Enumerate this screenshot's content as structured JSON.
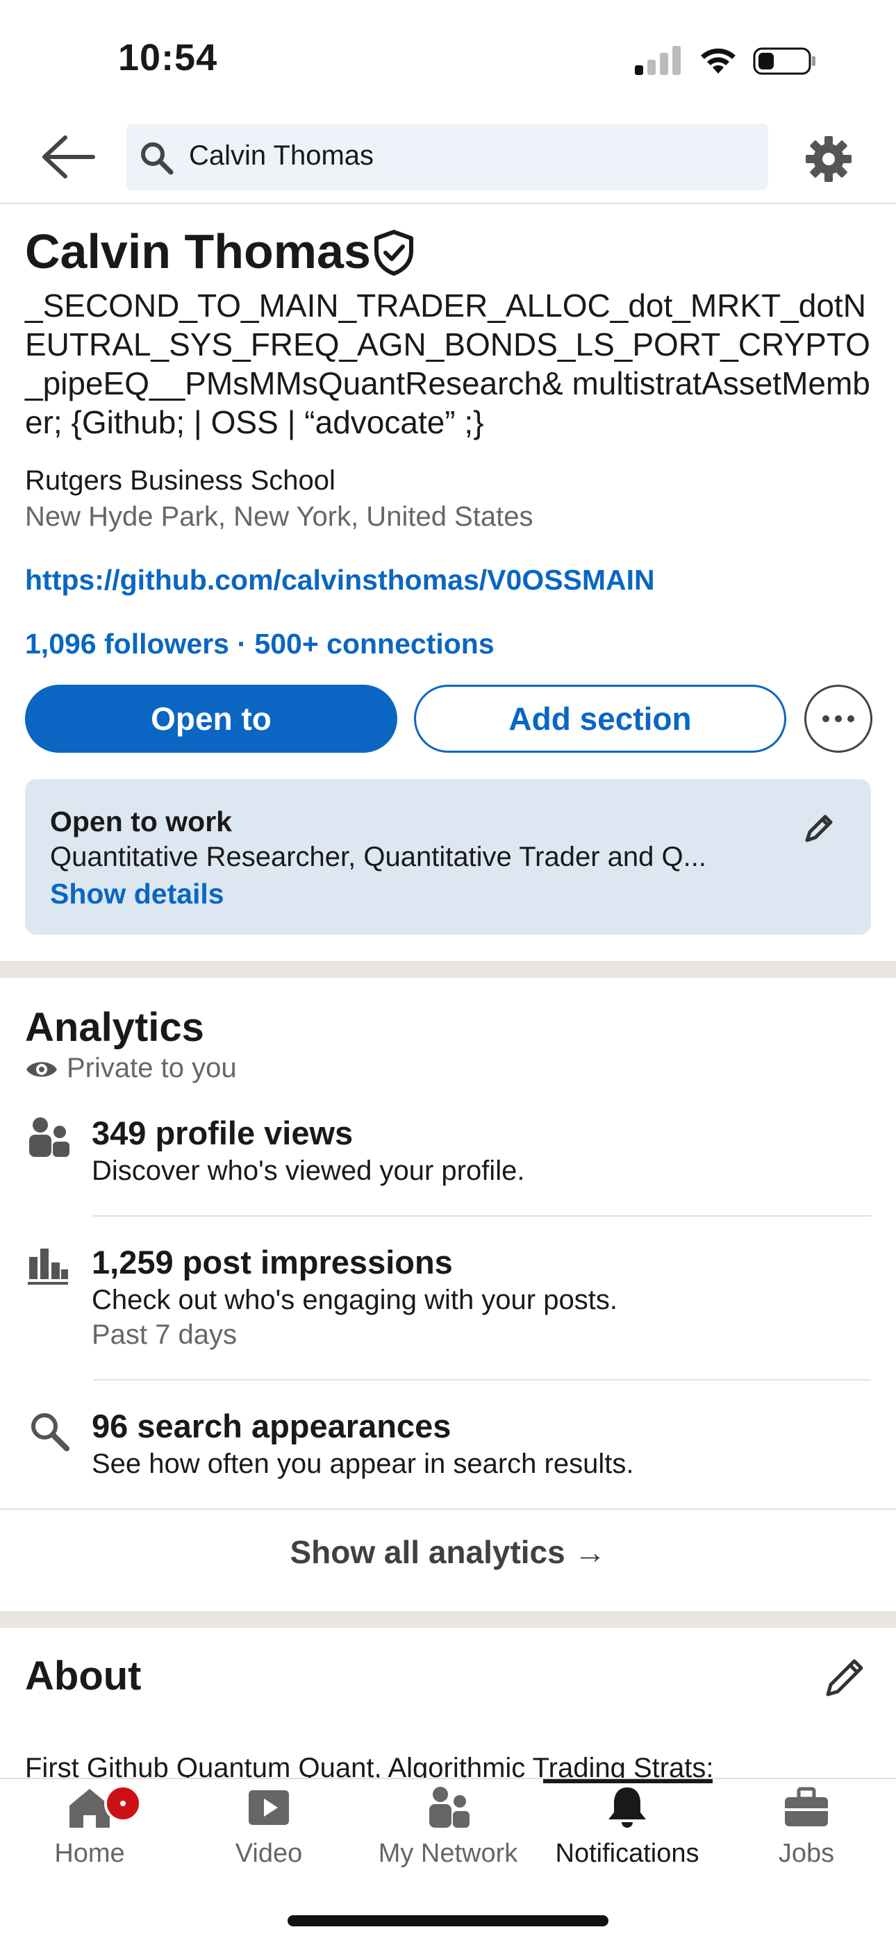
{
  "status_bar": {
    "time": "10:54"
  },
  "search": {
    "value": "Calvin Thomas"
  },
  "profile": {
    "name": "Calvin Thomas",
    "headline": "_SECOND_TO_MAIN_TRADER_ALLOC_dot_MRKT_dotNEUTRAL_SYS_FREQ_AGN_BONDS_LS_PORT_CRYPTO_pipeEQ__PMsMMsQuantResearch& multistratAssetMember; {Github; | OSS | “advocate” ;}",
    "school": "Rutgers Business School",
    "location": "New Hyde Park, New York, United States",
    "link": "https://github.com/calvinsthomas/V0OSSMAIN",
    "followers": "1,096 followers",
    "separator": " · ",
    "connections": "500+ connections"
  },
  "actions": {
    "open_to": "Open to",
    "add_section": "Add section"
  },
  "open_to_work": {
    "title": "Open to work",
    "description": "Quantitative Researcher, Quantitative Trader and Q...",
    "show_details": "Show details"
  },
  "analytics": {
    "title": "Analytics",
    "private": "Private to you",
    "items": [
      {
        "title": "349 profile views",
        "subtitle": "Discover who's viewed your profile.",
        "meta": "",
        "icon": "people-icon"
      },
      {
        "title": "1,259 post impressions",
        "subtitle": "Check out who's engaging with your posts.",
        "meta": "Past 7 days",
        "icon": "bar-chart-icon"
      },
      {
        "title": "96 search appearances",
        "subtitle": "See how often you appear in search results.",
        "meta": "",
        "icon": "search-icon"
      }
    ],
    "show_all": "Show all analytics →"
  },
  "about": {
    "title": "About",
    "text": "First Github Quantum Quant, Algorithmic Trading Strats:"
  },
  "bottom_nav": {
    "items": [
      {
        "label": "Home",
        "icon": "home-icon",
        "active": false
      },
      {
        "label": "Video",
        "icon": "video-icon",
        "active": false
      },
      {
        "label": "My Network",
        "icon": "my-network-icon",
        "active": false
      },
      {
        "label": "Notifications",
        "icon": "bell-icon",
        "active": true
      },
      {
        "label": "Jobs",
        "icon": "briefcase-icon",
        "active": false
      }
    ]
  },
  "colors": {
    "accent": "#0a66c2",
    "badge": "#cc1016",
    "card": "#dde7f1"
  }
}
